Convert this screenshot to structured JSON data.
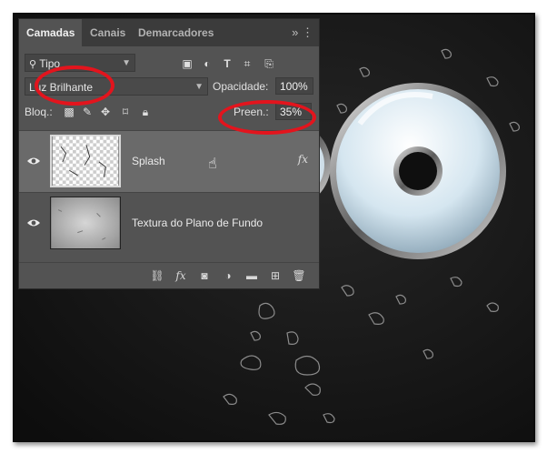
{
  "tabs": [
    {
      "label": "Camadas",
      "active": true
    },
    {
      "label": "Canais",
      "active": false
    },
    {
      "label": "Demarcadores",
      "active": false
    }
  ],
  "filter": {
    "search_icon": "search-icon",
    "value": "Tipo"
  },
  "blend_mode": {
    "value": "Luz Brilhante"
  },
  "opacity": {
    "label": "Opacidade:",
    "value": "100%"
  },
  "lock": {
    "label": "Bloq.:"
  },
  "fill": {
    "label": "Preen.:",
    "value": "35%"
  },
  "layers": [
    {
      "name": "Splash",
      "selected": true,
      "has_fx": true,
      "fx_label": "fx"
    },
    {
      "name": "Textura do Plano de Fundo",
      "selected": false,
      "has_fx": false
    }
  ],
  "bottom_fx_label": "fx",
  "colors": {
    "panel": "#535353",
    "tabbar": "#3b3b3b",
    "highlight": "#e3141d",
    "selected_layer": "#6a6a6a"
  }
}
